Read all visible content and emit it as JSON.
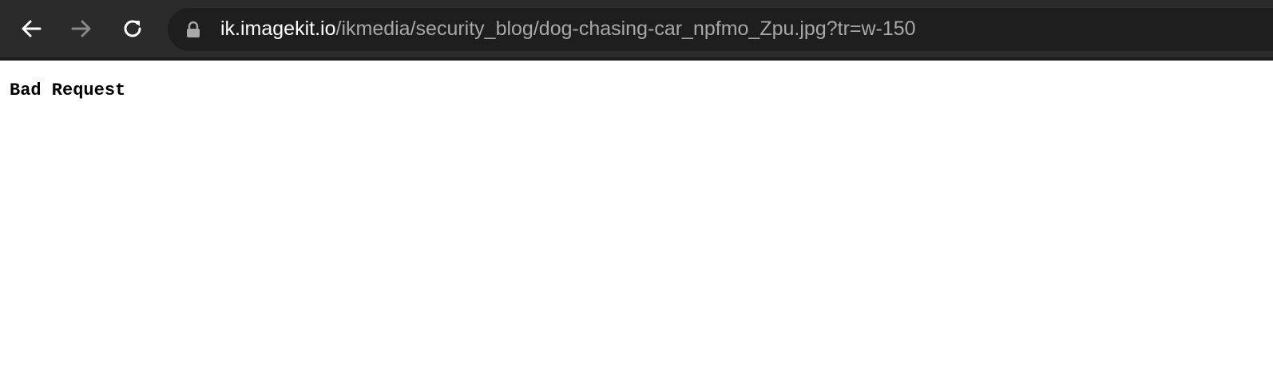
{
  "browser": {
    "back_icon": "arrow-left-icon",
    "forward_icon": "arrow-right-icon",
    "reload_icon": "reload-icon",
    "lock_icon": "lock-icon",
    "url_host": "ik.imagekit.io",
    "url_path": "/ikmedia/security_blog/dog-chasing-car_npfmo_Zpu.jpg?tr=w-150",
    "colors": {
      "toolbar": "#2b2b2b",
      "omnibox": "#1e1e1e",
      "url_host": "#ffffff",
      "url_path": "#a8a8a8"
    }
  },
  "page": {
    "body_text": "Bad Request"
  }
}
